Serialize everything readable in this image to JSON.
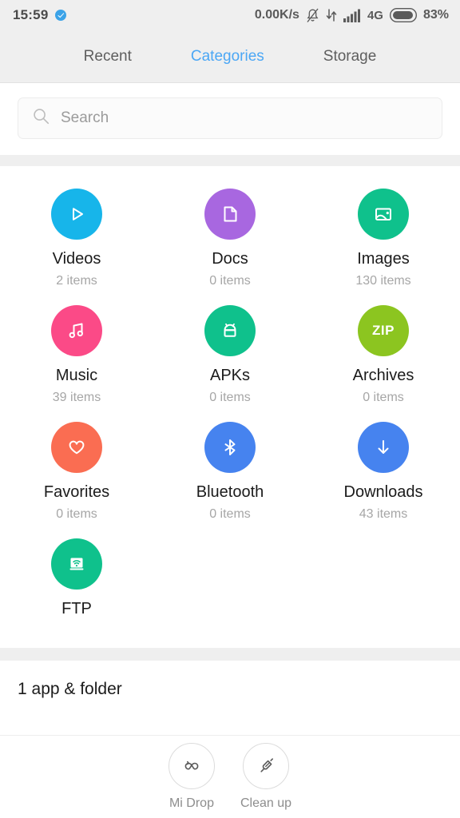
{
  "statusbar": {
    "time": "15:59",
    "badge_icon": "telegram-icon",
    "net_speed": "0.00K/s",
    "silent_icon": "bell-muted-icon",
    "data_icon": "data-transfer-icon",
    "signal_icon": "signal-bars-icon",
    "network": "4G",
    "battery_icon": "battery-icon",
    "battery_pct": "83%"
  },
  "tabs": [
    {
      "label": "Recent",
      "active": false,
      "name": "tab-recent"
    },
    {
      "label": "Categories",
      "active": true,
      "name": "tab-categories"
    },
    {
      "label": "Storage",
      "active": false,
      "name": "tab-storage"
    }
  ],
  "search": {
    "placeholder": "Search",
    "value": "",
    "icon": "search-icon"
  },
  "categories": [
    {
      "name": "Videos",
      "count": "2 items",
      "color": "#17b5ea",
      "icon": "play-icon",
      "key": "videos"
    },
    {
      "name": "Docs",
      "count": "0 items",
      "color": "#a867e0",
      "icon": "document-icon",
      "key": "docs"
    },
    {
      "name": "Images",
      "count": "130 items",
      "color": "#0fc18c",
      "icon": "image-icon",
      "key": "images"
    },
    {
      "name": "Music",
      "count": "39 items",
      "color": "#fb4a87",
      "icon": "music-note-icon",
      "key": "music"
    },
    {
      "name": "APKs",
      "count": "0 items",
      "color": "#0fc18c",
      "icon": "android-icon",
      "key": "apks"
    },
    {
      "name": "Archives",
      "count": "0 items",
      "color": "#8cc520",
      "icon": "zip-icon",
      "key": "archives",
      "icon_text": "ZIP"
    },
    {
      "name": "Favorites",
      "count": "0 items",
      "color": "#fa6d52",
      "icon": "heart-icon",
      "key": "favorites"
    },
    {
      "name": "Bluetooth",
      "count": "0 items",
      "color": "#4683ef",
      "icon": "bluetooth-icon",
      "key": "bluetooth"
    },
    {
      "name": "Downloads",
      "count": "43 items",
      "color": "#4683ef",
      "icon": "download-arrow-icon",
      "key": "downloads"
    },
    {
      "name": "FTP",
      "count": "",
      "color": "#0fc18c",
      "icon": "ftp-wifi-icon",
      "key": "ftp"
    }
  ],
  "lower": {
    "section_title": "1 app & folder"
  },
  "toolbar": {
    "items": [
      {
        "label": "Mi Drop",
        "icon": "mi-drop-icon",
        "name": "mi-drop-button"
      },
      {
        "label": "Clean up",
        "icon": "broom-icon",
        "name": "clean-up-button"
      }
    ]
  },
  "colors": {
    "accent": "#4ba7f5",
    "status_bg": "#efefef",
    "page_bg": "#ffffff"
  }
}
